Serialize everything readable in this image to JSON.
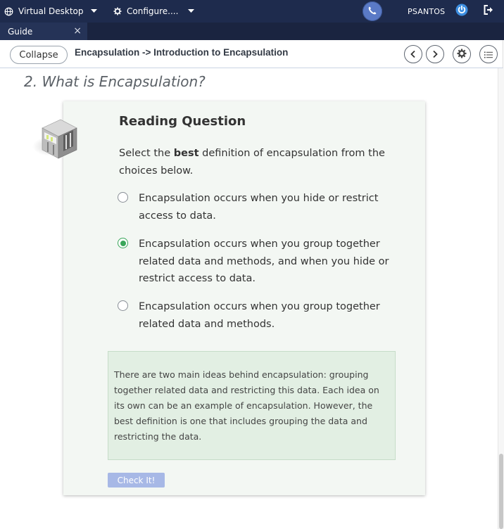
{
  "topbar": {
    "virtual_desktop": "Virtual Desktop",
    "configure": "Configure....",
    "username": "PSANTOS"
  },
  "tabs": [
    {
      "label": "Guide",
      "close": "×"
    }
  ],
  "header": {
    "collapse_label": "Collapse",
    "breadcrumb": "Encapsulation -> Introduction to Encapsulation"
  },
  "content": {
    "section_title": "2. What is Encapsulation?",
    "question": {
      "title": "Reading Question",
      "prompt_before": "Select the ",
      "prompt_bold": "best",
      "prompt_after": " definition of encapsulation from the choices below.",
      "choices": [
        {
          "text": "Encapsulation occurs when you hide or restrict access to data.",
          "selected": false
        },
        {
          "text": "Encapsulation occurs when you group together related data and methods, and when you hide or restrict access to data.",
          "selected": true
        },
        {
          "text": "Encapsulation occurs when you group together related data and methods.",
          "selected": false
        }
      ],
      "feedback": "There are two main ideas behind encapsulation: grouping together related data and restricting this data. Each idea on its own can be an example of encapsulation. However, the best definition is one that includes grouping the data and restricting the data.",
      "check_label": "Check It!"
    }
  },
  "colors": {
    "topbar": "#1e2b4d",
    "accent_green": "#3aa65a",
    "button_blue": "#a7b8e6"
  }
}
